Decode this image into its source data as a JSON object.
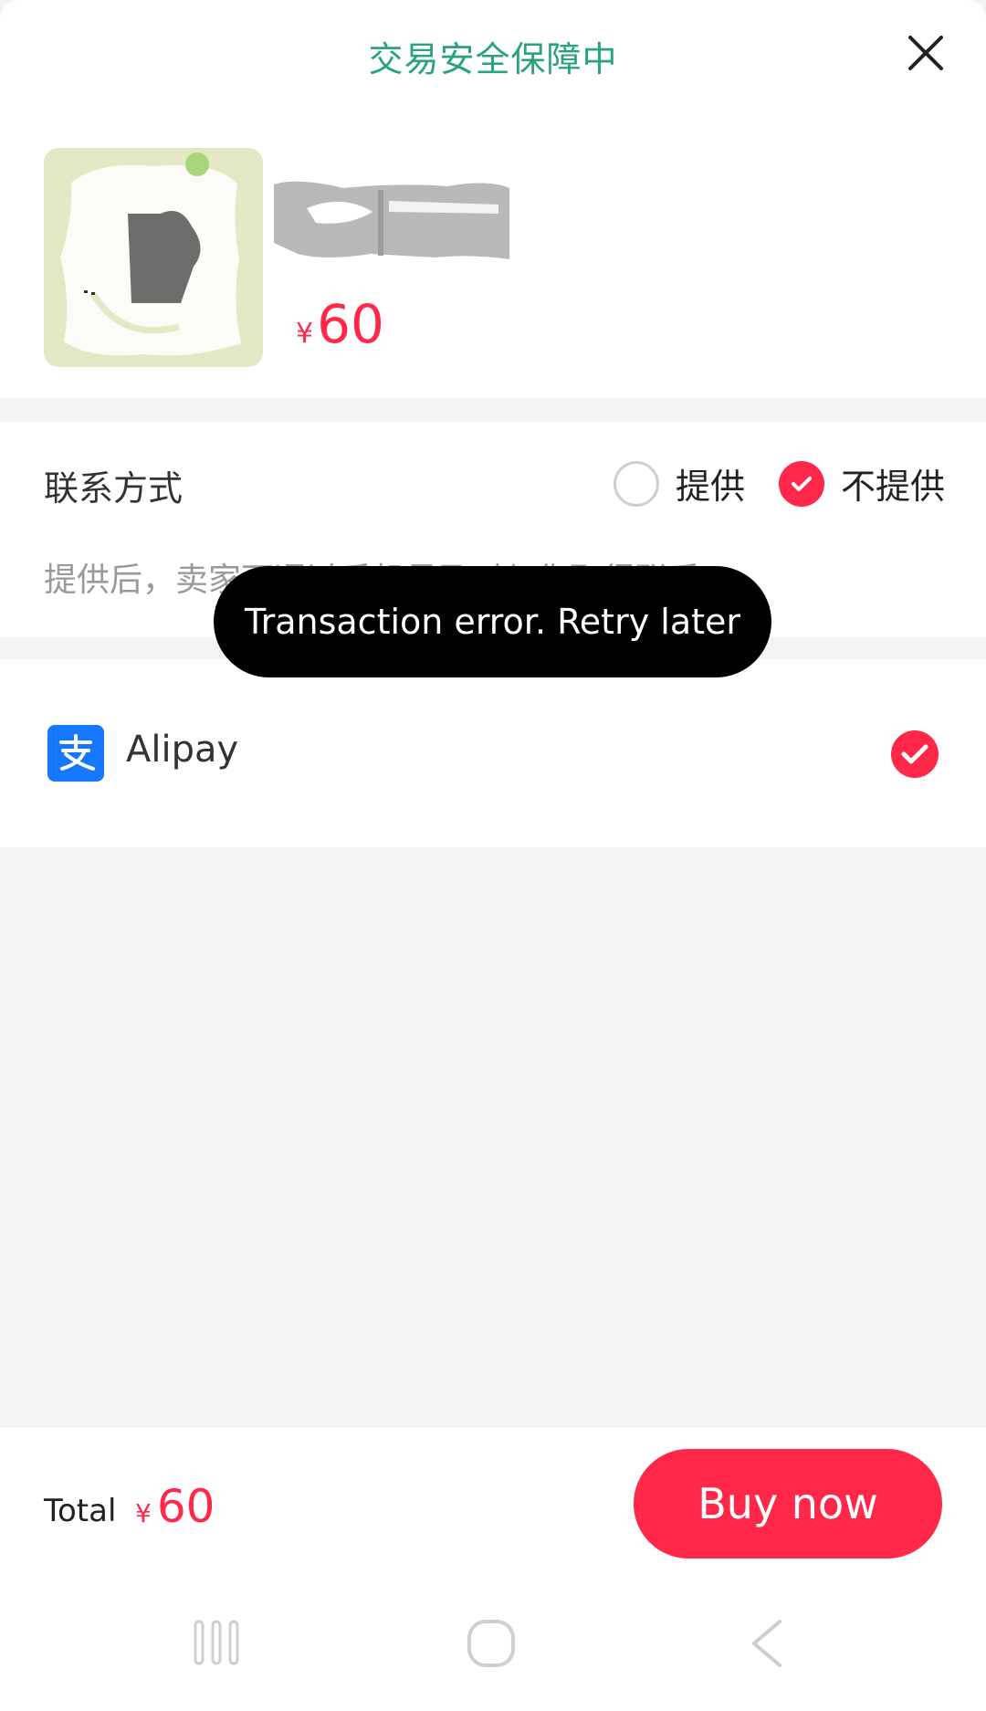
{
  "header": {
    "title": "交易安全保障中",
    "close_icon": "close-icon"
  },
  "product": {
    "price_currency": "¥",
    "price_value": "60"
  },
  "contact": {
    "label": "联系方式",
    "option_provide": "提供",
    "option_not_provide": "不提供",
    "selected": "不提供",
    "hint": "提供后，卖家可通过手机号及时与你取得联系"
  },
  "toast": {
    "message": "Transaction error. Retry later"
  },
  "payment": {
    "method_label": "Alipay",
    "icon": "alipay-icon",
    "selected": true
  },
  "bottom": {
    "total_label": "Total",
    "total_currency": "¥",
    "total_value": "60",
    "buy_label": "Buy now"
  },
  "navigation": {
    "buttons": [
      "recent-apps-icon",
      "home-icon",
      "back-icon"
    ]
  },
  "colors": {
    "accent_red": "#ff2848",
    "header_green": "#2aa37a",
    "alipay_blue": "#1677ff"
  }
}
